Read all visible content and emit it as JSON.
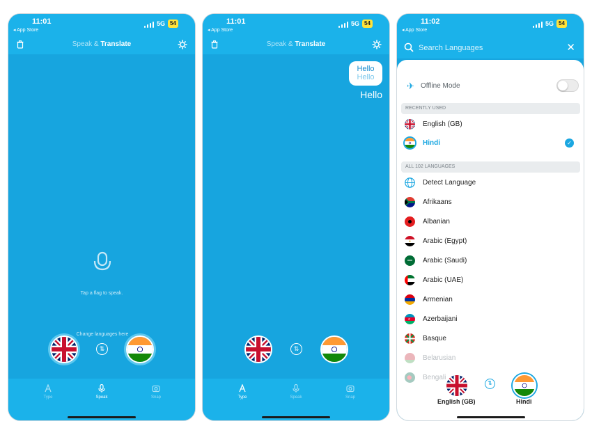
{
  "status": {
    "time_1": "11:01",
    "time_2": "11:01",
    "time_3": "11:02",
    "back_label": "◂ App Store",
    "network": "5G",
    "battery": "54"
  },
  "header": {
    "title_part1": "Speak & ",
    "title_part2": "Translate"
  },
  "tabs": [
    {
      "label": "Type",
      "icon": "type-icon"
    },
    {
      "label": "Speak",
      "icon": "mic-icon"
    },
    {
      "label": "Snap",
      "icon": "camera-icon"
    }
  ],
  "screen1": {
    "hint": "Tap a flag to speak.",
    "change_hint": "Change languages here",
    "active_tab": "Speak"
  },
  "screen2": {
    "bubble_source": "Hello",
    "bubble_translation": "Hello",
    "output": "Hello",
    "active_tab": "Type"
  },
  "screen3": {
    "search_placeholder": "Search Languages",
    "offline_label": "Offline Mode",
    "offline_enabled": false,
    "recent_header": "RECENTLY USED",
    "recent": [
      {
        "name": "English (GB)",
        "flag": "uk-flag"
      },
      {
        "name": "Hindi",
        "flag": "india-flag",
        "selected": true
      }
    ],
    "all_header": "ALL 102 LANGUAGES",
    "languages": [
      {
        "name": "Detect Language",
        "flag": "globe-icon"
      },
      {
        "name": "Afrikaans",
        "flag": "south-africa-flag"
      },
      {
        "name": "Albanian",
        "flag": "albania-flag"
      },
      {
        "name": "Arabic (Egypt)",
        "flag": "egypt-flag"
      },
      {
        "name": "Arabic (Saudi)",
        "flag": "saudi-flag"
      },
      {
        "name": "Arabic (UAE)",
        "flag": "uae-flag"
      },
      {
        "name": "Armenian",
        "flag": "armenia-flag"
      },
      {
        "name": "Azerbaijani",
        "flag": "azerbaijan-flag"
      },
      {
        "name": "Basque",
        "flag": "basque-flag"
      },
      {
        "name": "Belarusian",
        "flag": "belarus-flag"
      },
      {
        "name": "Bengali",
        "flag": "bangladesh-flag"
      }
    ],
    "bottom_left_label": "English (GB)",
    "bottom_right_label": "Hindi"
  },
  "colors": {
    "primary": "#17a5df",
    "bar": "#1bb2ea",
    "accent": "#1ba7e1"
  }
}
